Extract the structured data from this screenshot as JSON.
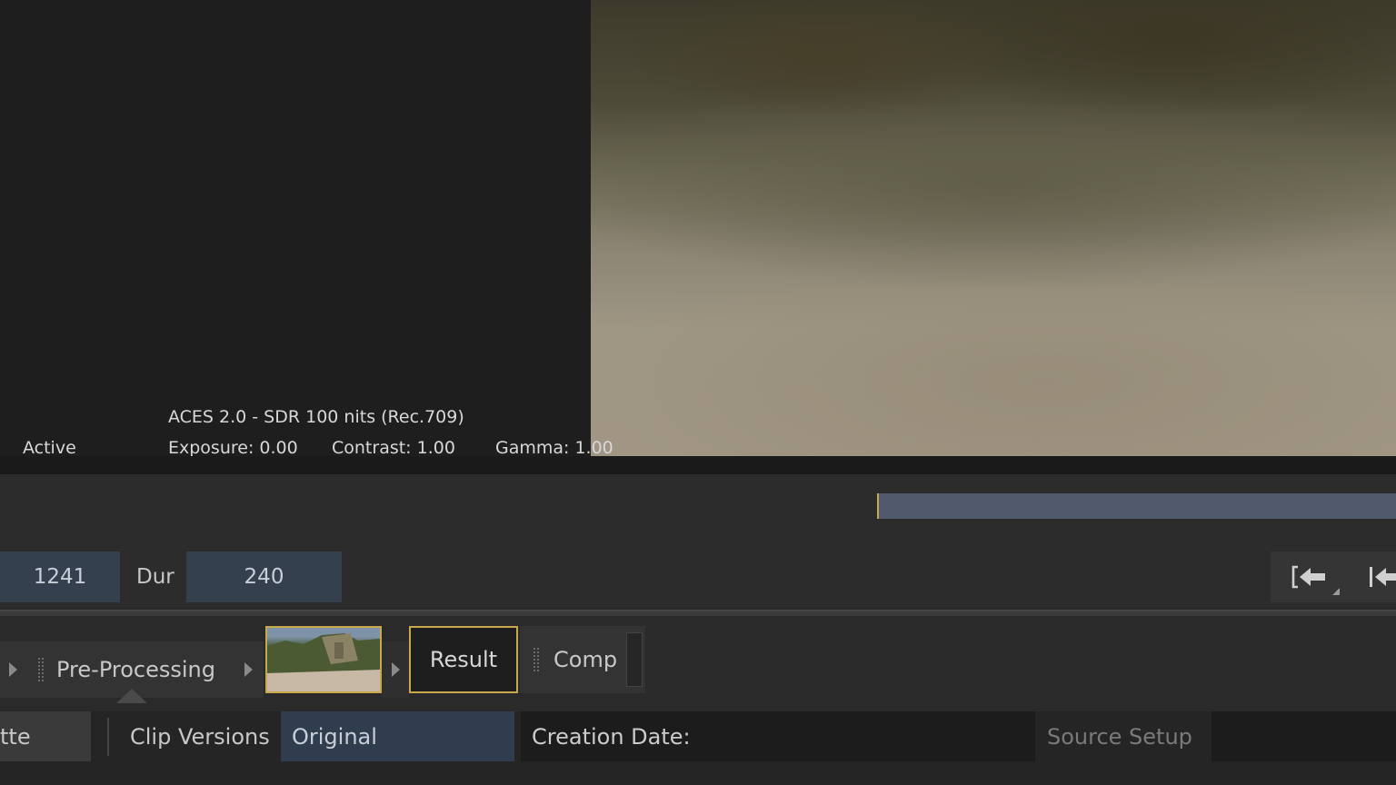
{
  "viewer": {
    "view_transform": "ACES 2.0 - SDR 100 nits (Rec.709)",
    "status": "Active",
    "exposure": "Exposure: 0.00",
    "contrast": "Contrast: 1.00",
    "gamma": "Gamma: 1.00"
  },
  "timeline": {
    "frame_value": "1241",
    "dur_label": "Dur",
    "dur_value": "240"
  },
  "pipeline": {
    "nodes": [
      {
        "label": "Pre-Processing"
      },
      {
        "label": "Result"
      },
      {
        "label": "Comp"
      }
    ]
  },
  "bottom": {
    "truncated_tab": "tte",
    "clip_versions_label": "Clip Versions",
    "clip_versions_value": "Original",
    "creation_date_label": "Creation Date:",
    "source_setup_label": "Source Setup"
  },
  "icons": {
    "transport": [
      "go-to-in-point-icon",
      "go-to-start-icon"
    ],
    "pipeline": [
      "grip-icon",
      "chevron-right-icon",
      "selection-caret-icon"
    ]
  },
  "colors": {
    "accent": "#c8a84a",
    "field_blue": "#34404d",
    "timeline_range": "#515a6c",
    "panel_dark": "#1e1e1e"
  }
}
